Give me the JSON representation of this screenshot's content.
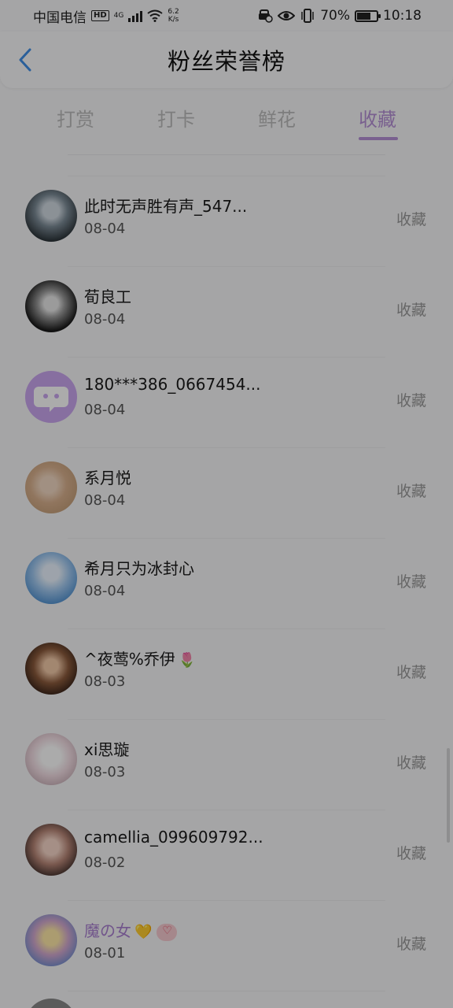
{
  "status_bar": {
    "carrier": "中国电信",
    "hd": "HD",
    "network": "4G",
    "speed_value": "6.2",
    "speed_unit": "K/s",
    "battery": "70%",
    "time": "10:18"
  },
  "header": {
    "title": "粉丝荣誉榜"
  },
  "tabs": [
    {
      "label": "打赏"
    },
    {
      "label": "打卡"
    },
    {
      "label": "鲜花"
    },
    {
      "label": "收藏",
      "active": true
    }
  ],
  "list": [
    {
      "name": "此时无声胜有声_547...",
      "date": "08-04",
      "action": "收藏"
    },
    {
      "name": "荀良工",
      "date": "08-04",
      "action": "收藏"
    },
    {
      "name": "180***386_0667454...",
      "date": "08-04",
      "action": "收藏"
    },
    {
      "name": "系月悦",
      "date": "08-04",
      "action": "收藏"
    },
    {
      "name": "希月只为冰封心",
      "date": "08-04",
      "action": "收藏"
    },
    {
      "name": "^夜莺%乔伊",
      "date": "08-03",
      "action": "收藏",
      "emoji": "🌷"
    },
    {
      "name": "xi思璇",
      "date": "08-03",
      "action": "收藏"
    },
    {
      "name": "camellia_099609792...",
      "date": "08-02",
      "action": "收藏"
    },
    {
      "name": "魔の女",
      "date": "08-01",
      "action": "收藏",
      "emoji": "💛"
    }
  ],
  "colors": {
    "accent": "#b58fd6",
    "overlay": "rgba(0,0,0,0.33)"
  }
}
